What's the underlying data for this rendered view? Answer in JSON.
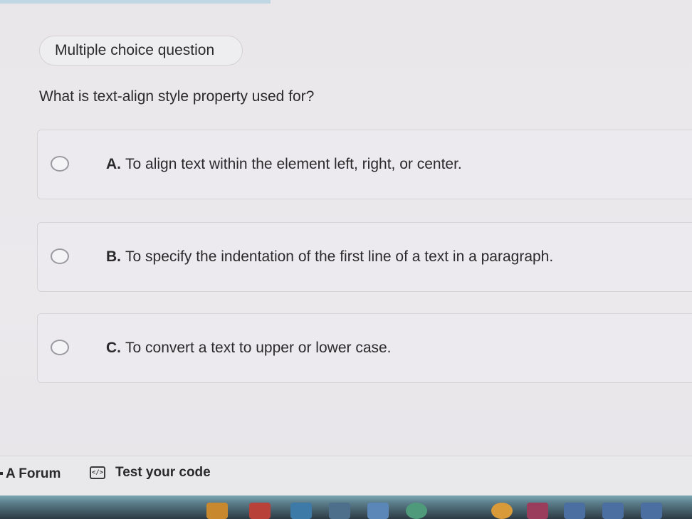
{
  "badge": {
    "label": "Multiple choice question"
  },
  "question": {
    "text": "What is text-align style property used for?"
  },
  "options": [
    {
      "letter": "A.",
      "text": "To align text within the element left, right, or center."
    },
    {
      "letter": "B.",
      "text": "To specify the indentation of the first line of a text in a paragraph."
    },
    {
      "letter": "C.",
      "text": "To convert a text to upper or lower case."
    }
  ],
  "footer": {
    "forum_label": "A Forum",
    "test_code_label": "Test your code",
    "test_code_icon": "code-brackets-icon"
  },
  "colors": {
    "background": "#eae8eb",
    "text": "#2a2a2c",
    "border": "#d6d4d9",
    "accent_strip": "#bfd8e4"
  }
}
